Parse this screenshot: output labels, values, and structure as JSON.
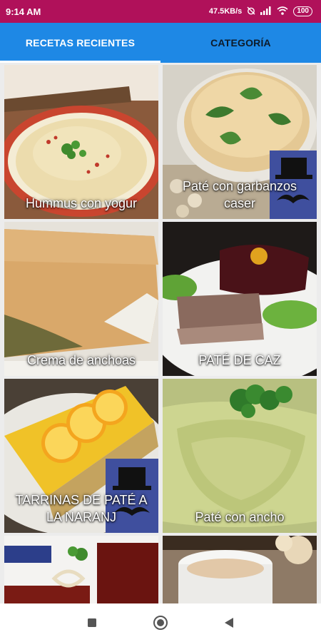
{
  "status": {
    "time": "9:14 AM",
    "speed": "47.5KB/s",
    "battery": "100"
  },
  "tabs": [
    {
      "label": "RECETAS RECIENTES",
      "active": true
    },
    {
      "label": "CATEGORÍA",
      "active": false
    }
  ],
  "recipes": [
    {
      "title": "Hummus con yogur",
      "image": "hummus-photo"
    },
    {
      "title": "Paté con garbanzos caser",
      "image": "hummus-bowl-photo"
    },
    {
      "title": "Crema de anchoas",
      "image": "loaf-photo"
    },
    {
      "title": "PATÉ DE CAZ",
      "image": "pate-plate-photo"
    },
    {
      "title": "TARRINAS DE PATÉ A LA NARANJ",
      "image": "orange-terrine-photo"
    },
    {
      "title": "Paté con ancho",
      "image": "stuffed-leaves-photo"
    },
    {
      "title": "",
      "image": "chocolate-cake-photo"
    },
    {
      "title": "",
      "image": "pate-jar-photo"
    }
  ],
  "colors": {
    "statusbar": "#b0115a",
    "tabbar": "#1e88e5",
    "badge": "#3f4f9e"
  }
}
